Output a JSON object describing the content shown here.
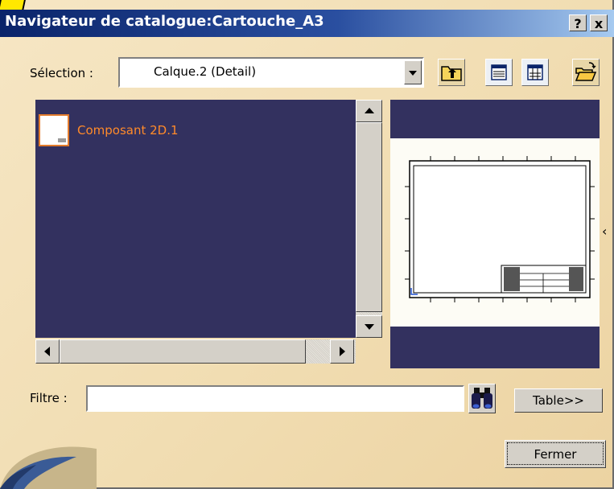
{
  "window": {
    "title": "Navigateur de catalogue:Cartouche_A3",
    "help_label": "?",
    "close_label": "x"
  },
  "selection": {
    "label": "Sélection :",
    "value": "Calque.2 (Detail)"
  },
  "list": {
    "items": [
      {
        "label": "Composant 2D.1"
      }
    ]
  },
  "filter": {
    "label": "Filtre :",
    "value": ""
  },
  "buttons": {
    "table_label": "Table>>",
    "close_dialog_label": "Fermer"
  },
  "colors": {
    "title_bar": "#0a246a",
    "pane_background": "#33315f",
    "item_text": "#ff8a2a",
    "dialog_background": "#f3dfb6"
  },
  "icons": [
    "parent-folder-icon",
    "details-view-icon",
    "list-view-icon",
    "open-folder-icon",
    "binoculars-icon"
  ]
}
